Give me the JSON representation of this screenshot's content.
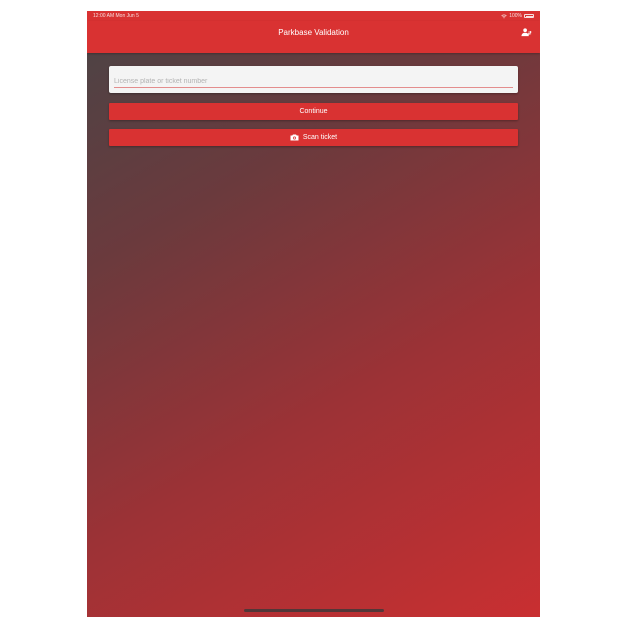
{
  "status_bar": {
    "time_date": "12:00 AM   Mon Jun 5",
    "battery": "100%"
  },
  "nav": {
    "title": "Parkbase Validation",
    "account_icon": "account-switch-icon"
  },
  "search": {
    "placeholder": "License plate or ticket number",
    "value": ""
  },
  "buttons": {
    "continue_label": "Continue",
    "scan_label": "Scan ticket",
    "scan_icon": "camera-icon"
  },
  "colors": {
    "accent": "#d93232",
    "gradient_start": "#4a4446",
    "gradient_end": "#c92f31"
  }
}
